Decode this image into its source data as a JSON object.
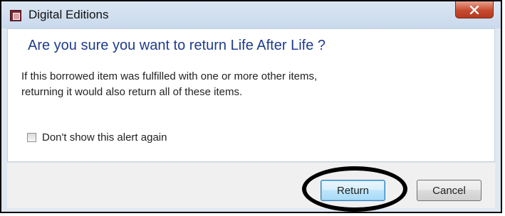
{
  "window": {
    "title": "Digital Editions",
    "app_icon": "digital-editions-app-icon",
    "close_icon": "close-x-icon"
  },
  "dialog": {
    "heading": "Are you sure you want to return Life After Life ?",
    "message_line1": "If this borrowed item was fulfilled with one or more other items,",
    "message_line2": "returning it would also return all of these items.",
    "checkbox_label": "Don't show this alert again",
    "checkbox_checked": false
  },
  "buttons": {
    "return_label": "Return",
    "cancel_label": "Cancel"
  },
  "colors": {
    "heading": "#1e3c8c",
    "close_button": "#c64b2f",
    "annotation_ellipse": "#000000"
  }
}
